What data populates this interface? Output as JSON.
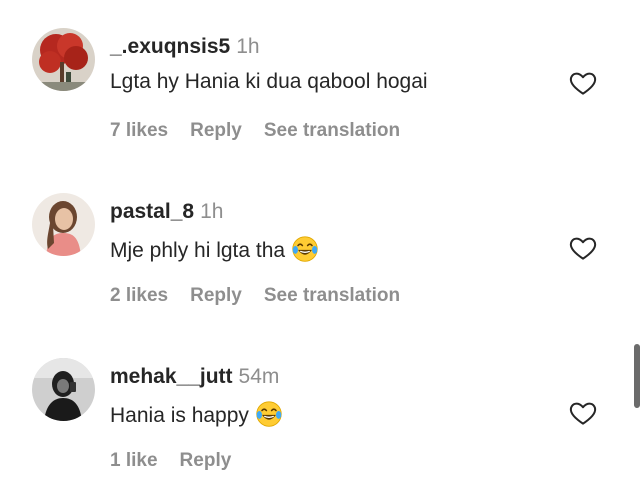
{
  "comments": [
    {
      "username": "_.exuqnsis5",
      "time": "1h",
      "text": "Lgta hy Hania ki dua qabool hogai",
      "has_emoji": false,
      "likes": "7 likes",
      "reply": "Reply",
      "translation": "See translation",
      "avatar_icon": "avatar-red-tree-photo"
    },
    {
      "username": "pastal_8",
      "time": "1h",
      "text": "Mje phly hi lgta tha",
      "has_emoji": true,
      "emoji": "face-with-tears-of-joy-icon",
      "likes": "2 likes",
      "reply": "Reply",
      "translation": "See translation",
      "avatar_icon": "avatar-woman-pink-photo"
    },
    {
      "username": "mehak__jutt",
      "time": "54m",
      "text": "Hania is happy",
      "has_emoji": true,
      "emoji": "face-with-tears-of-joy-icon",
      "likes": "1 like",
      "reply": "Reply",
      "translation": "",
      "avatar_icon": "avatar-dark-selfie-photo"
    }
  ],
  "colors": {
    "text": "#262626",
    "secondary": "#8e8e8e",
    "background": "#ffffff",
    "scrollbar": "#6b6b6b"
  }
}
